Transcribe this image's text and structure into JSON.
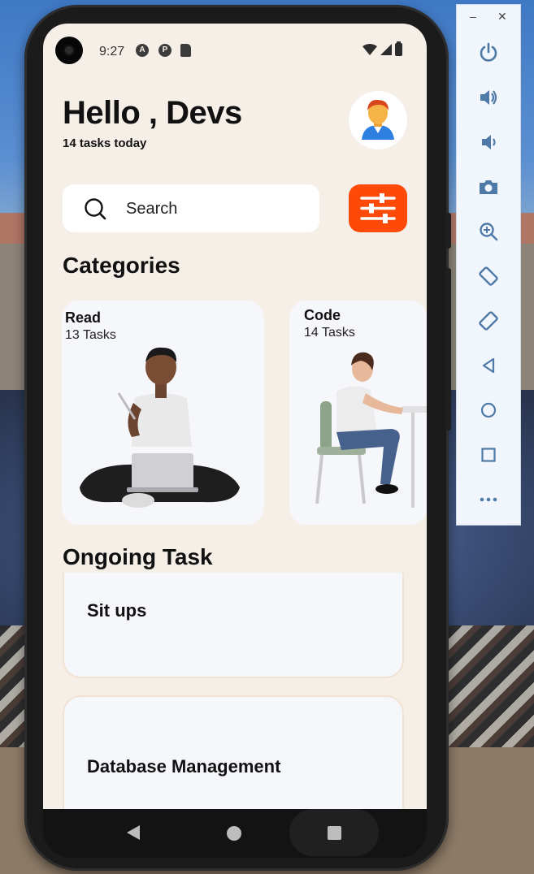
{
  "status_bar": {
    "time": "9:27",
    "icons": [
      "camera-icon",
      "a-icon",
      "p-icon",
      "sd-card-icon",
      "wifi-icon",
      "signal-icon",
      "battery-icon"
    ]
  },
  "header": {
    "greeting": "Hello , Devs",
    "subtitle": "14 tasks today"
  },
  "search": {
    "placeholder": "Search"
  },
  "colors": {
    "accent": "#fd4a08",
    "background": "#f6efe8",
    "card": "#f6f7fb",
    "task_border": "#f1e2d3"
  },
  "categories": {
    "title": "Categories",
    "items": [
      {
        "name": "Read",
        "count": "13 Tasks"
      },
      {
        "name": "Code",
        "count": "14 Tasks"
      }
    ]
  },
  "ongoing": {
    "title": "Ongoing Task",
    "items": [
      {
        "title": "Sit ups"
      },
      {
        "title": "Database Management"
      }
    ]
  },
  "emulator_toolbar": {
    "window_controls": {
      "minimize": "–",
      "close": "✕"
    },
    "buttons": [
      "power-icon",
      "volume-up-icon",
      "volume-down-icon",
      "screenshot-icon",
      "zoom-icon",
      "rotate-left-icon",
      "rotate-right-icon",
      "back-icon",
      "home-icon",
      "overview-icon",
      "more-icon"
    ]
  }
}
